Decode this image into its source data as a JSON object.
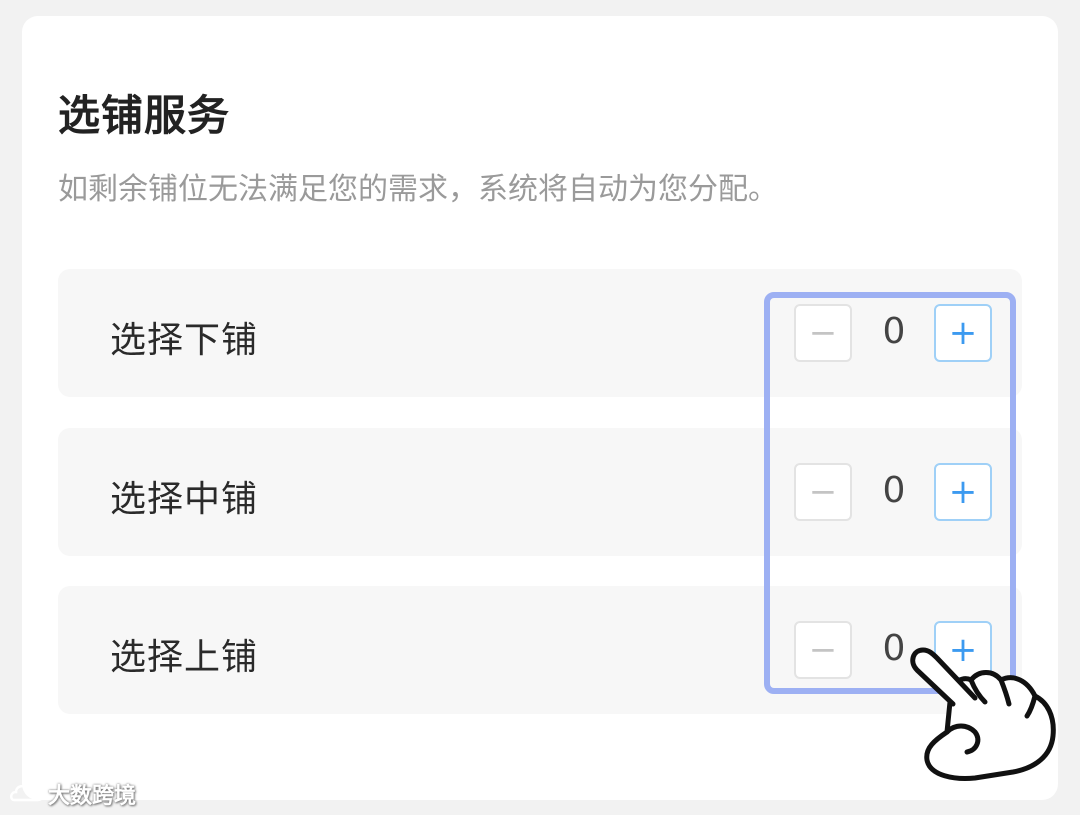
{
  "section": {
    "title": "选铺服务",
    "subtitle": "如剩余铺位无法满足您的需求，系统将自动为您分配。"
  },
  "berths": [
    {
      "label": "选择下铺",
      "value": "0",
      "minus_icon": "minus-icon",
      "plus_icon": "plus-icon"
    },
    {
      "label": "选择中铺",
      "value": "0",
      "minus_icon": "minus-icon",
      "plus_icon": "plus-icon"
    },
    {
      "label": "选择上铺",
      "value": "0",
      "minus_icon": "minus-icon",
      "plus_icon": "plus-icon"
    }
  ],
  "symbols": {
    "minus": "−",
    "plus": "+"
  },
  "overlay": {
    "highlight_color": "#9db0f3",
    "pointer_icon": "hand-pointer-icon"
  },
  "watermark": {
    "text": "大数跨境",
    "logo_icon": "cloud-logo-icon"
  },
  "colors": {
    "accent": "#3c9af0",
    "row_background": "#f7f7f7",
    "subtitle": "#9a9a9a"
  }
}
